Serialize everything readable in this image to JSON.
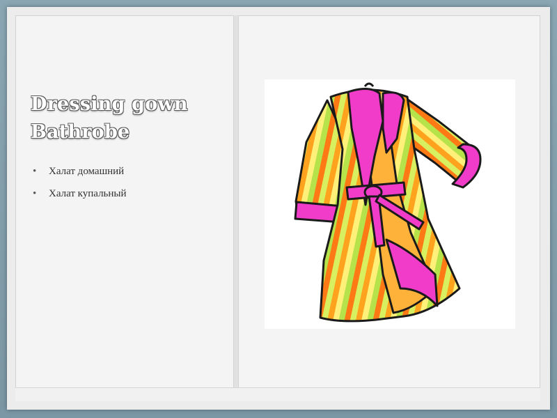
{
  "slide": {
    "title_line1": "Dressing gown",
    "title_line2": "Bathrobe",
    "bullets": [
      "Халат домашний",
      "Халат купальный"
    ]
  },
  "image": {
    "icon": "bathrobe-illustration-icon"
  },
  "colors": {
    "background": "#7f9aa9",
    "slide": "#f4f4f4",
    "robe_pink": "#f03cc8",
    "robe_orange": "#ffa21e",
    "robe_green": "#b6e24a",
    "robe_yellow": "#fff07a"
  }
}
